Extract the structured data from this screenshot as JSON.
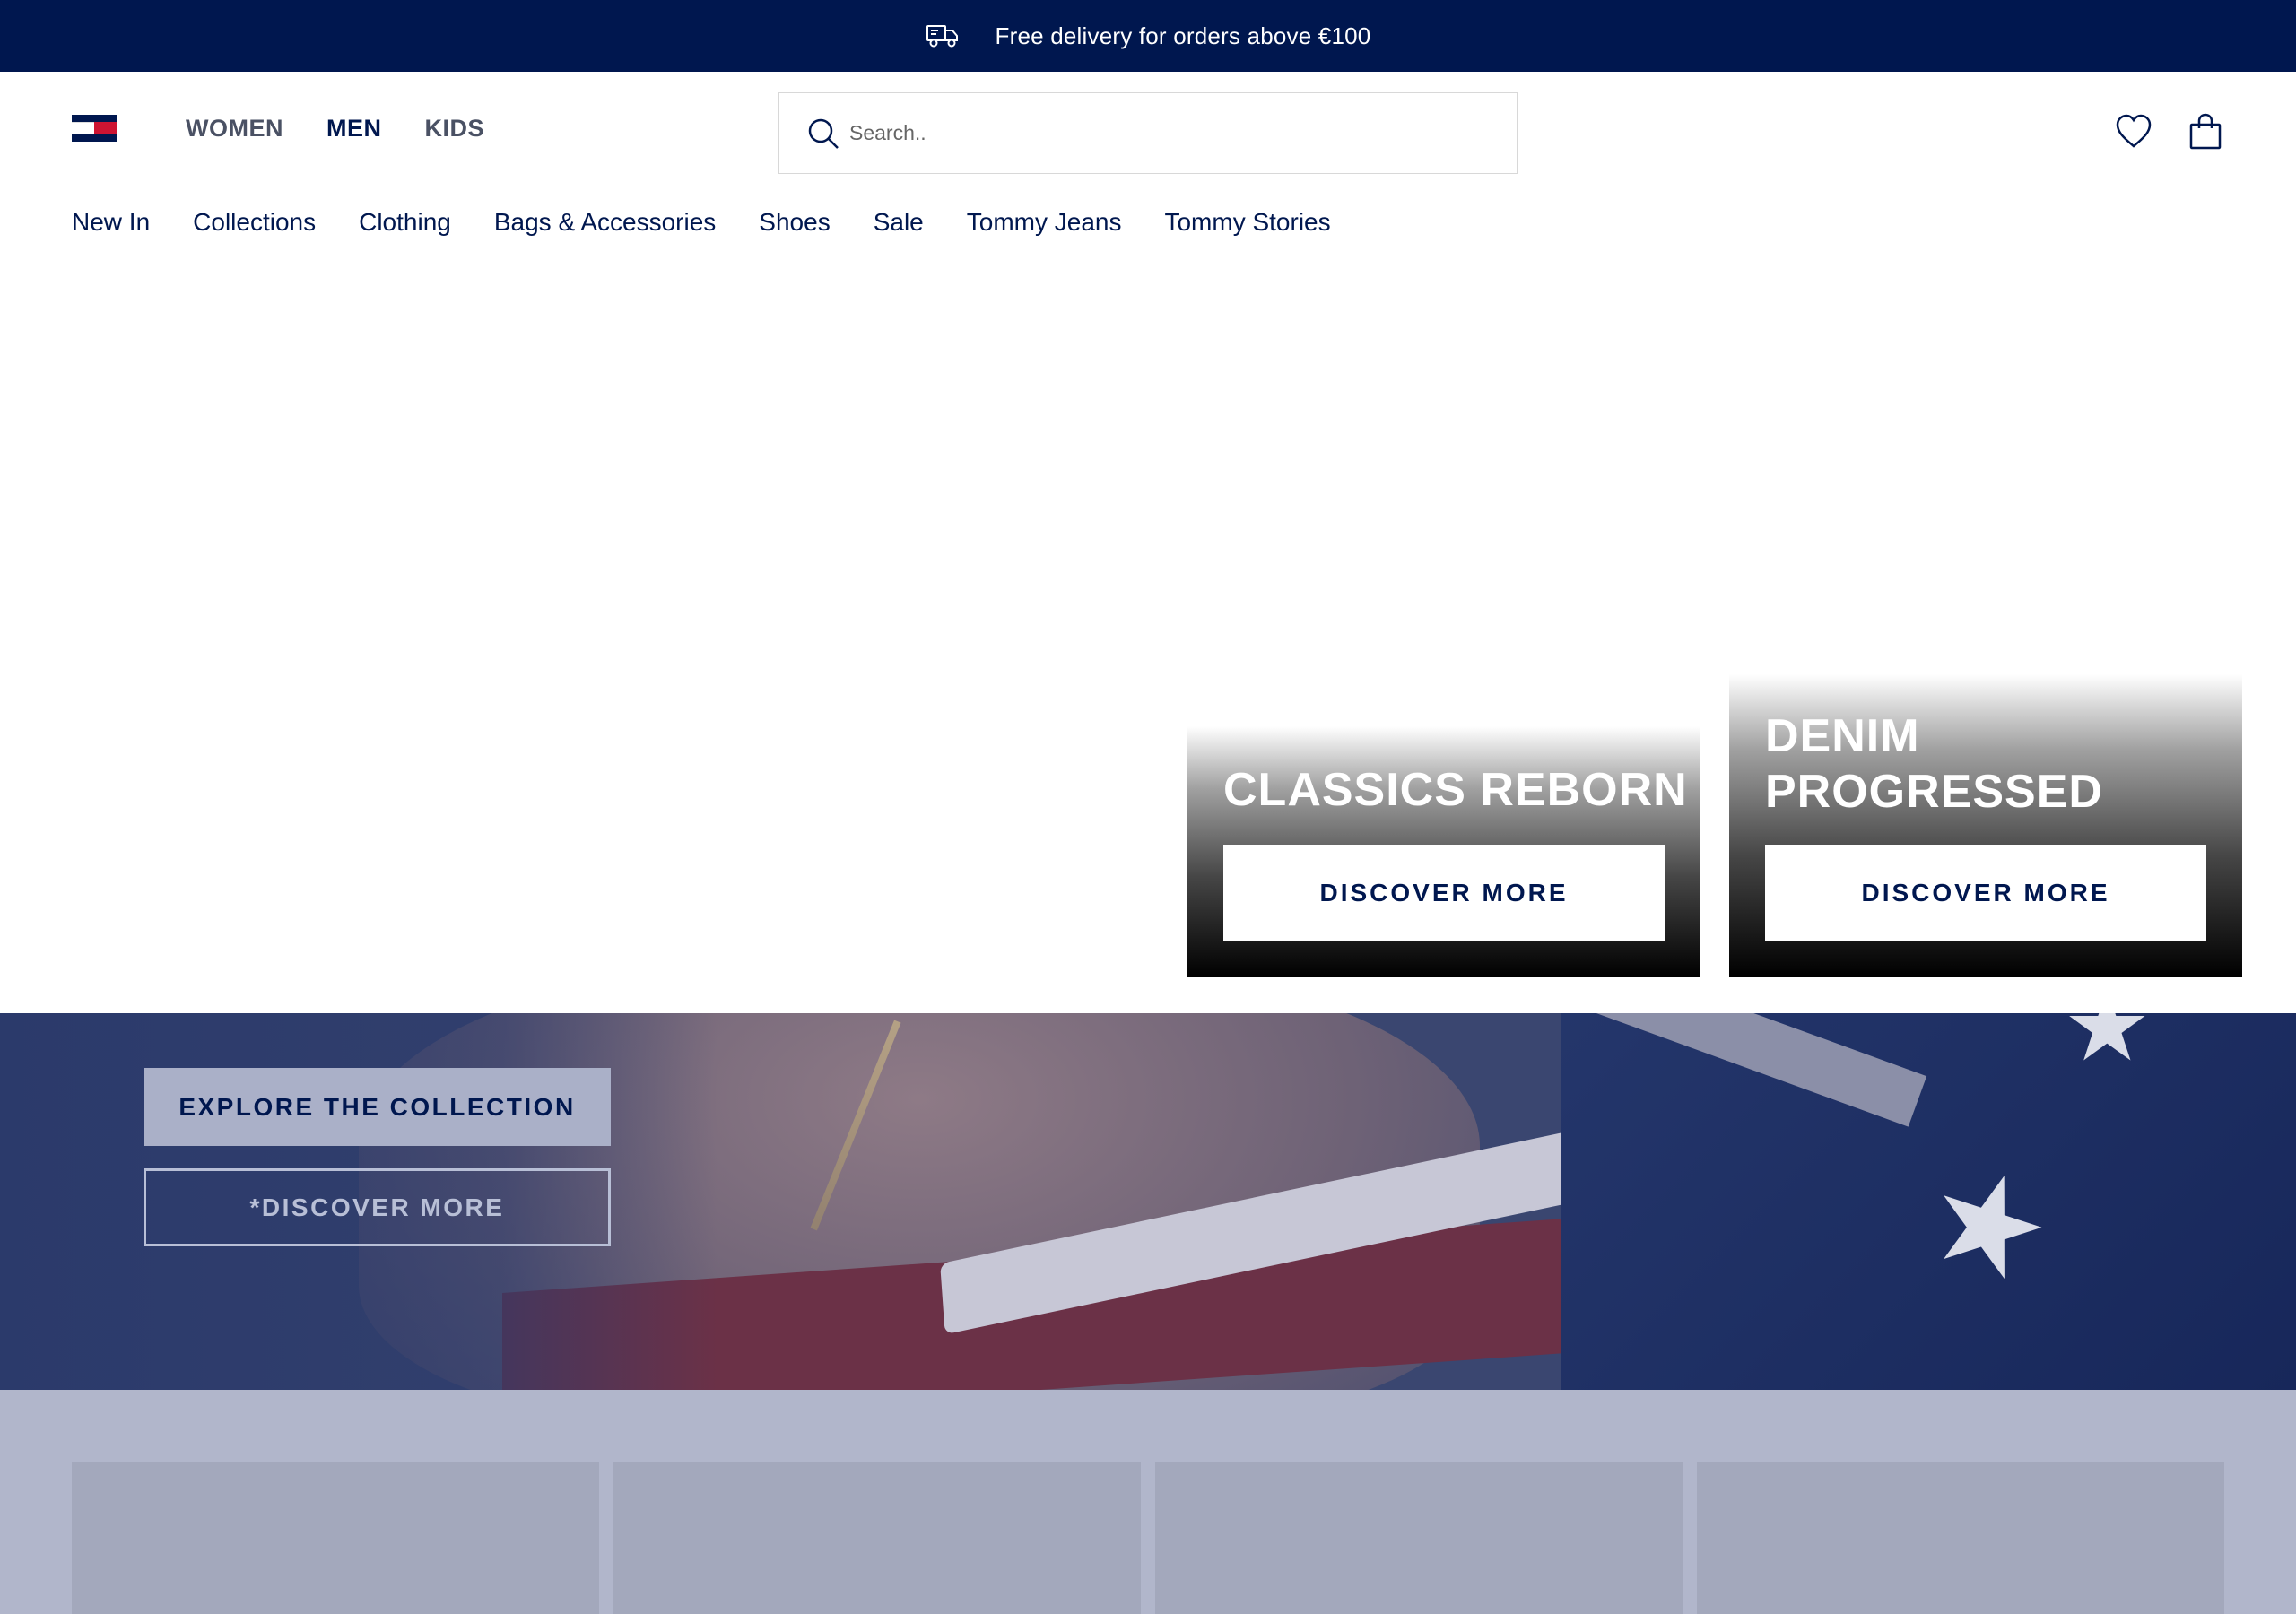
{
  "promo": {
    "icon": "truck-icon",
    "text": "Free delivery for orders above €100"
  },
  "header": {
    "gender_nav": [
      "WOMEN",
      "MEN",
      "KIDS"
    ],
    "gender_active": "MEN",
    "search_placeholder": "Search..",
    "icons": [
      "search-icon",
      "heart-icon",
      "shopping-bag-icon"
    ]
  },
  "categories": [
    "New In",
    "Collections",
    "Clothing",
    "Bags & Accessories",
    "Shoes",
    "Sale",
    "Tommy Jeans",
    "Tommy Stories"
  ],
  "cards": [
    {
      "title": "CLASSICS REBORN",
      "button": "DISCOVER MORE"
    },
    {
      "title": "DENIM PROGRESSED",
      "button": "DISCOVER MORE"
    }
  ],
  "hero": {
    "explore_button": "EXPLORE THE COLLECTION",
    "discover_button": "*DISCOVER MORE"
  },
  "colors": {
    "navy": "#00174f",
    "promo_bg": "#00174f",
    "lower_bg": "#b1b6cb",
    "tile_bg": "#a3a8bc"
  }
}
